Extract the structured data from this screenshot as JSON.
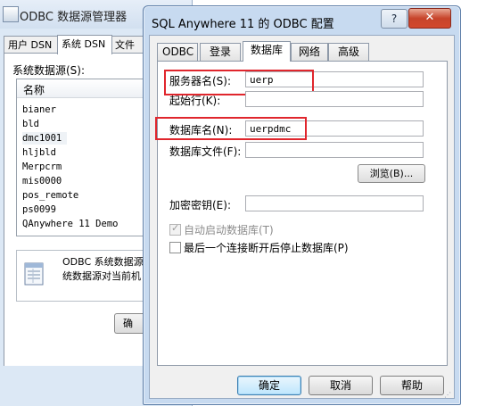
{
  "background_window": {
    "title": "ODBC 数据源管理器",
    "tabs": [
      {
        "label": "用户 DSN",
        "active": false
      },
      {
        "label": "系统 DSN",
        "active": true
      },
      {
        "label": "文件",
        "active": false
      }
    ],
    "list_label": "系统数据源(S):",
    "list_header": "名称",
    "data_sources": [
      "bianer",
      "bld",
      "dmc1001",
      "hljbld",
      "Merpcrm",
      "mis0000",
      "pos_remote",
      "ps0099",
      "QAnywhere 11 Demo"
    ],
    "info_text_line1": "ODBC 系统数据源",
    "info_text_line2": "统数据源对当前机",
    "ok_label": "确"
  },
  "dialog": {
    "title": "SQL Anywhere 11 的 ODBC 配置",
    "help_button": "?",
    "close_button": "✕",
    "tabs": [
      {
        "label": "ODBC",
        "active": false
      },
      {
        "label": "登录",
        "active": false
      },
      {
        "label": "数据库",
        "active": true
      },
      {
        "label": "网络",
        "active": false
      },
      {
        "label": "高级",
        "active": false
      }
    ],
    "fields": {
      "server_name_label": "服务器名(S):",
      "server_name_value": "uerp",
      "start_line_label": "起始行(K):",
      "start_line_value": "",
      "database_name_label": "数据库名(N):",
      "database_name_value": "uerpdmc",
      "database_file_label": "数据库文件(F):",
      "database_file_value": "",
      "browse_label": "浏览(B)...",
      "encryption_key_label": "加密密钥(E):",
      "encryption_key_value": ""
    },
    "checkboxes": {
      "auto_start_label": "自动启动数据库(T)",
      "auto_start_checked": true,
      "auto_start_enabled": false,
      "stop_after_disconnect_label": "最后一个连接断开后停止数据库(P)",
      "stop_after_disconnect_checked": false
    },
    "buttons": {
      "ok": "确定",
      "cancel": "取消",
      "help": "帮助"
    },
    "highlight_color": "#e0262d"
  }
}
